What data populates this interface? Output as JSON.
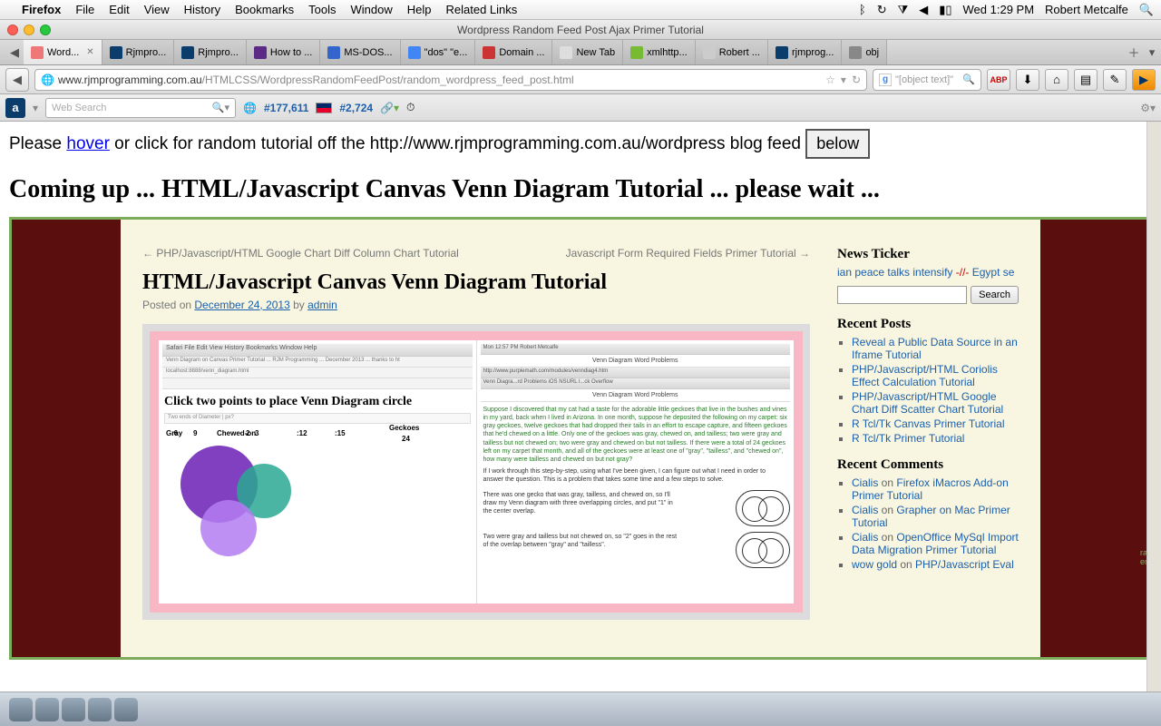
{
  "menubar": {
    "app": "Firefox",
    "items": [
      "File",
      "Edit",
      "View",
      "History",
      "Bookmarks",
      "Tools",
      "Window",
      "Help",
      "Related Links"
    ],
    "clock": "Wed 1:29 PM",
    "user": "Robert Metcalfe"
  },
  "window": {
    "title": "Wordpress Random Feed Post Ajax Primer Tutorial"
  },
  "tabs": [
    {
      "label": "Word...",
      "active": true
    },
    {
      "label": "Rjmpro..."
    },
    {
      "label": "Rjmpro..."
    },
    {
      "label": "How to ..."
    },
    {
      "label": "MS-DOS..."
    },
    {
      "label": "\"dos\" \"e..."
    },
    {
      "label": "Domain ..."
    },
    {
      "label": "New Tab"
    },
    {
      "label": "xmlhttp..."
    },
    {
      "label": "Robert ..."
    },
    {
      "label": "rjmprog..."
    },
    {
      "label": "obj"
    }
  ],
  "url": {
    "domain": "www.rjmprogramming.com.au",
    "path": "/HTMLCSS/WordpressRandomFeedPost/random_wordpress_feed_post.html"
  },
  "search": {
    "placeholder": "\"[object text]\""
  },
  "ext": {
    "web_search_ph": "Web Search",
    "rank1": "#177,611",
    "rank2": "#2,724"
  },
  "page": {
    "intro_pre": "Please ",
    "intro_hover": "hover",
    "intro_post": " or click for random tutorial off the http://www.rjmprogramming.com.au/wordpress blog feed ",
    "below": "below",
    "coming": "Coming up ... HTML/Javascript Canvas Venn Diagram Tutorial ... please wait ..."
  },
  "post": {
    "nav_prev": "← PHP/Javascript/HTML Google Chart Diff Column Chart Tutorial",
    "nav_next": "Javascript Form Required Fields Primer Tutorial →",
    "title": "HTML/Javascript Canvas Venn Diagram Tutorial",
    "posted_on": "Posted on ",
    "date": "December 24, 2013",
    "by": " by ",
    "author": "admin"
  },
  "screenshot": {
    "left_title": "Click two points to place Venn Diagram circle",
    "left_bar": "Safari  File  Edit  View  History  Bookmarks  Window  Help",
    "left_bar2": "Venn Diagram on Canvas Primer Tutorial ... RJM Programming ... December 2013 ... thanks to ht",
    "left_url": "localhost:8888/venn_diagram.html",
    "fields": "Two ends of Diameter          | px?",
    "labels": {
      "gray": "Gray",
      "n6": ":6",
      "n12": ":12",
      "chewed": "Chewed-on",
      "n9": "9",
      "n15": ":15",
      "geckoes": "Geckoes",
      "n24": "24",
      "n2": "2",
      "n3": "3"
    },
    "right_title": "Venn Diagram Word Problems",
    "right_clock": "Mon 12:57 PM   Robert Metcalfe",
    "right_url": "http://www.purplemath.com/modules/venndiag4.htm",
    "right_tabs": "Venn Diagra...rd Problems   iOS NSURL l...ck Overflow",
    "p1": "Suppose I discovered that my cat had a taste for the adorable little geckoes that live in the bushes and vines in my yard, back when I lived in Arizona. In one month, suppose he deposited the following on my carpet: six gray geckoes, twelve geckoes that had dropped their tails in an effort to escape capture, and fifteen geckoes that he'd chewed on a little. Only one of the geckoes was gray, chewed on, and tailless; two were gray and tailless but not chewed on; two were gray and chewed on but not tailless. If there were a total of 24 geckoes left on my carpet that month, and all of the geckoes were at least one of \"gray\", \"tailless\", and \"chewed on\", how many were tailless and chewed on but not gray?",
    "p2": "If I work through this step-by-step, using what I've been given, I can figure out what I need in order to answer the question. This is a problem that takes some time and a few steps to solve.",
    "p3": "There was one gecko that was gray, tailless, and chewed on, so I'll draw my Venn diagram with three overlapping circles, and put \"1\" in the center overlap.",
    "p4": "Two were gray and tailless but not chewed on, so \"2\" goes in the rest of the overlap between \"gray\" and \"tailless\"."
  },
  "sidebar": {
    "news_h": "News Ticker",
    "ticker_a": "ian peace talks intensify ",
    "ticker_sep": "-//-",
    "ticker_b": " Egypt se",
    "search_btn": "Search",
    "recent_posts_h": "Recent Posts",
    "recent_posts": [
      "Reveal a Public Data Source in an Iframe Tutorial",
      "PHP/Javascript/HTML Coriolis Effect Calculation Tutorial",
      "PHP/Javascript/HTML Google Chart Diff Scatter Chart Tutorial",
      "R Tcl/Tk Canvas Primer Tutorial",
      "R Tcl/Tk Primer Tutorial"
    ],
    "recent_comments_h": "Recent Comments",
    "comments": [
      {
        "a": "Cialis",
        "on": " on ",
        "b": "Firefox iMacros Add-on Primer Tutorial"
      },
      {
        "a": "Cialis",
        "on": " on ",
        "b": "Grapher on Mac Primer Tutorial"
      },
      {
        "a": "Cialis",
        "on": " on ",
        "b": "OpenOffice MySql Import Data Migration Primer Tutorial"
      },
      {
        "a": "wow gold",
        "on": " on ",
        "b": "PHP/Javascript Eval"
      }
    ]
  }
}
